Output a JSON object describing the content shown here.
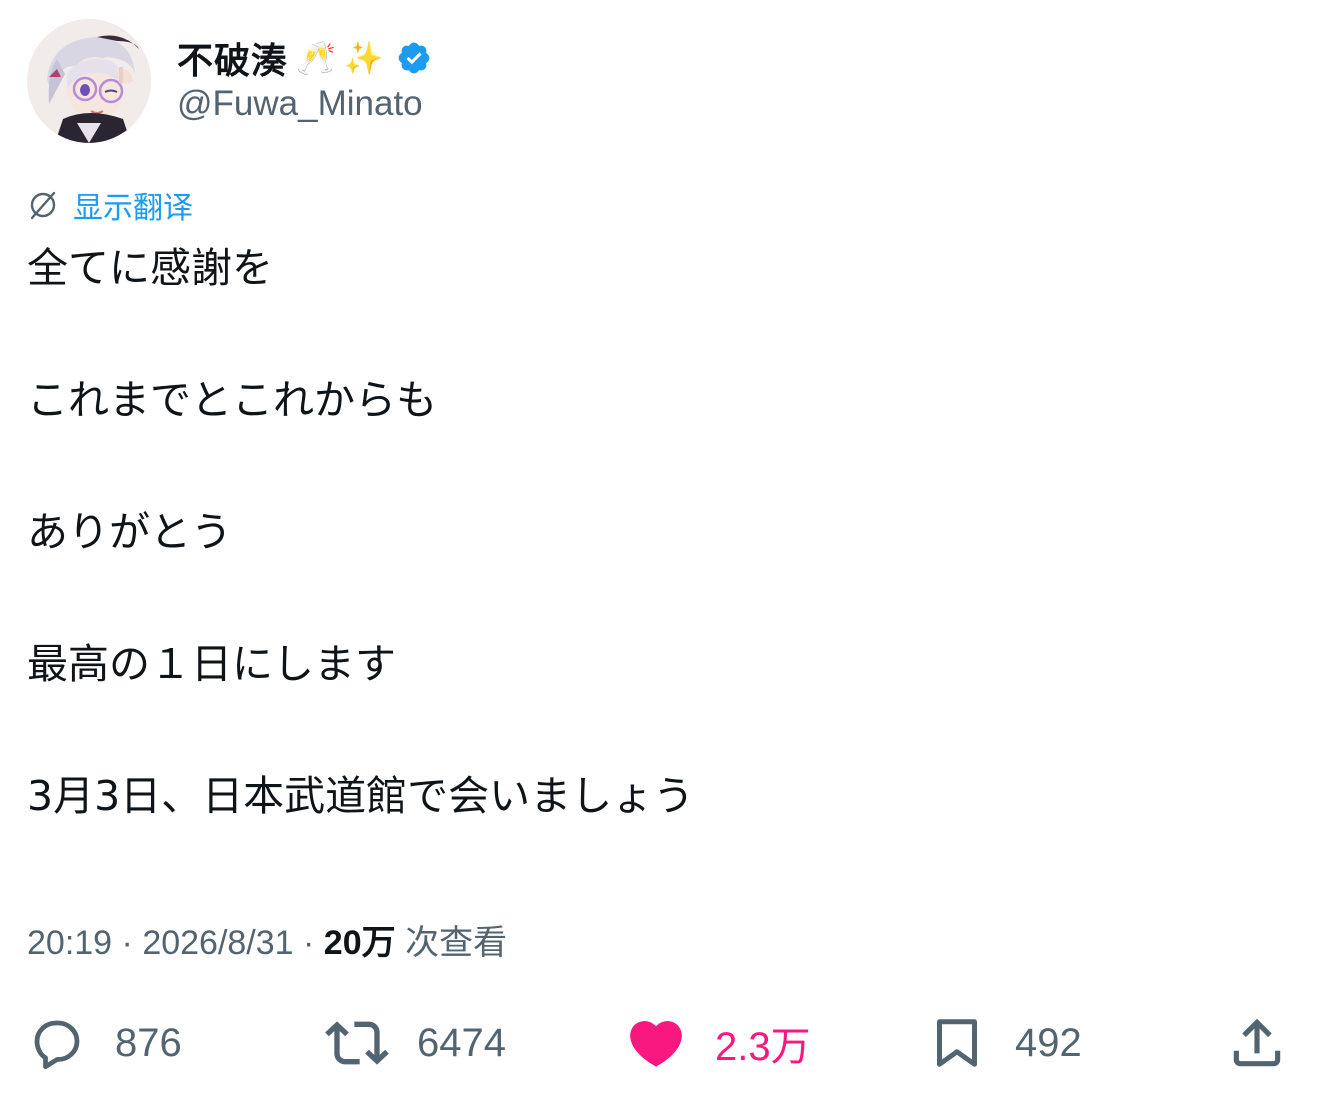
{
  "author": {
    "display_name": "不破湊",
    "emoji_1": "🥂",
    "emoji_2": "✨",
    "handle": "@Fuwa_Minato",
    "verified": true,
    "verified_color": "#1d9bf0"
  },
  "translate": {
    "icon": "globe-slash-icon",
    "label": "显示翻译",
    "color": "#1d9bf0"
  },
  "tweet": {
    "lines": [
      "全てに感謝を",
      "これまでとこれからも",
      "ありがとう",
      "最高の１日にします",
      "3月3日、日本武道館で会いましょう"
    ]
  },
  "meta": {
    "time": "20:19",
    "separator": " · ",
    "date": "2026/8/31",
    "views_count": "20万",
    "views_label": "次查看"
  },
  "actions": {
    "reply": {
      "icon": "reply-icon",
      "count": "876"
    },
    "retweet": {
      "icon": "retweet-icon",
      "count": "6474"
    },
    "like": {
      "icon": "heart-icon",
      "count": "2.3万",
      "active": true,
      "color": "#f91880"
    },
    "bookmark": {
      "icon": "bookmark-icon",
      "count": "492"
    },
    "share": {
      "icon": "share-icon"
    }
  }
}
